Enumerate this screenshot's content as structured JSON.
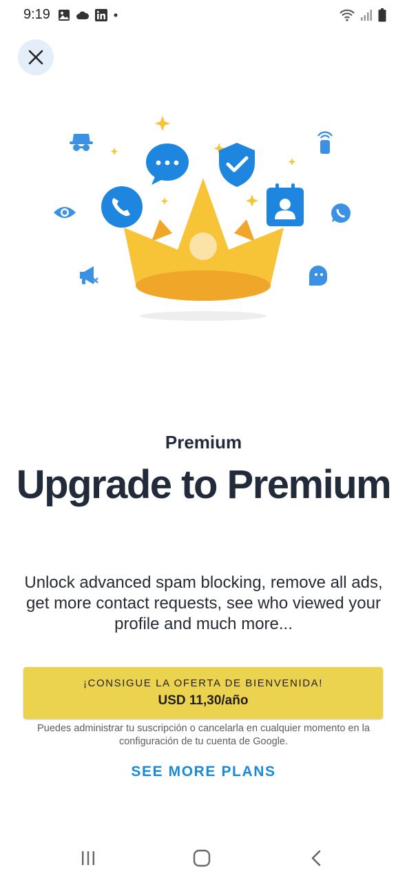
{
  "status_bar": {
    "time": "9:19",
    "left_icons": [
      "image-icon",
      "cloud-icon",
      "linkedin-icon",
      "notification-dot-icon"
    ],
    "right_icons": [
      "wifi-icon",
      "signal-icon",
      "battery-icon"
    ]
  },
  "header": {
    "close_icon": "close-icon"
  },
  "hero": {
    "illustration": "crown-with-communication-icons"
  },
  "content": {
    "eyebrow": "Premium",
    "headline": "Upgrade to Premium",
    "description": "Unlock advanced spam blocking, remove all ads, get more contact requests, see who viewed your profile and much more..."
  },
  "offer": {
    "label": "¡CONSIGUE LA OFERTA DE BIENVENIDA!",
    "price": "USD 11,30/año"
  },
  "disclaimer": "Puedes administrar tu suscripción o cancelarla en cualquier momento en la configuración de tu cuenta de Google.",
  "see_more_plans": "SEE MORE PLANS",
  "nav_bar": {
    "buttons": [
      "recents-icon",
      "home-icon",
      "back-icon"
    ]
  },
  "colors": {
    "accent": "#1a8ad6",
    "offer_button": "#ecd34f",
    "icon_blue": "#1f86e0",
    "crown_yellow": "#f7c437",
    "close_button_bg": "#e3eefa"
  }
}
